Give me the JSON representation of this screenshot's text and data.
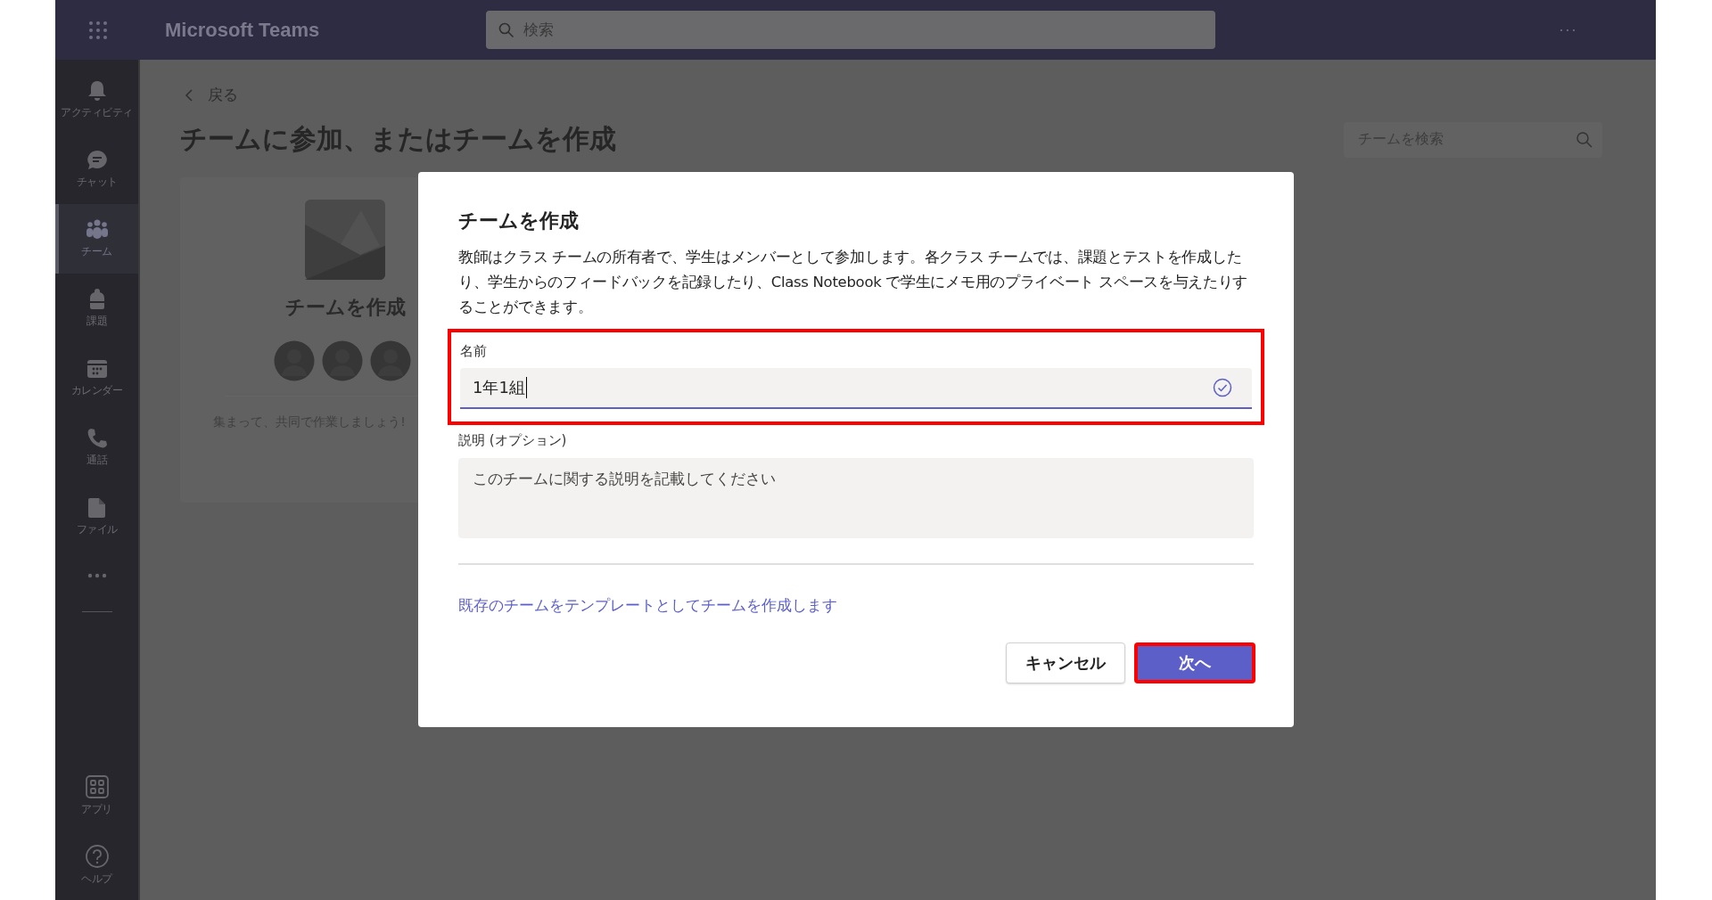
{
  "app_bar": {
    "title": "Microsoft Teams",
    "search": {
      "placeholder": "検索"
    },
    "more": "···"
  },
  "sidebar": {
    "items": [
      {
        "label": "アクティビティ",
        "selected": false
      },
      {
        "label": "チャット",
        "selected": false
      },
      {
        "label": "チーム",
        "selected": true
      },
      {
        "label": "課題",
        "selected": false
      },
      {
        "label": "カレンダー",
        "selected": false
      },
      {
        "label": "通話",
        "selected": false
      },
      {
        "label": "ファイル",
        "selected": false
      }
    ],
    "bottom_items": [
      {
        "label": "アプリ",
        "selected": false
      },
      {
        "label": "ヘルプ",
        "selected": false
      }
    ]
  },
  "page": {
    "back": "戻る",
    "title": "チームに参加、またはチームを作成",
    "search": {
      "placeholder": "チームを検索"
    },
    "card": {
      "title": "チームを作成",
      "caption": "集まって、共同で作業しましょう!"
    }
  },
  "dialog": {
    "title": "チームを作成",
    "description": "教師はクラス チームの所有者で、学生はメンバーとして参加します。各クラス チームでは、課題とテストを作成したり、学生からのフィードバックを記録したり、Class Notebook で学生にメモ用のプライベート スペースを与えたりすることができます。",
    "name_field": {
      "label": "名前",
      "value": "1年1組",
      "valid": true,
      "focused": true,
      "highlighted": true
    },
    "description_field": {
      "label": "説明 (オプション)",
      "placeholder": "このチームに関する説明を記載してください"
    },
    "template_link": "既存のチームをテンプレートとしてチームを作成します",
    "buttons": [
      {
        "label": "キャンセル",
        "primary": false,
        "highlighted": false
      },
      {
        "label": "次へ",
        "primary": true,
        "highlighted": true
      }
    ]
  }
}
